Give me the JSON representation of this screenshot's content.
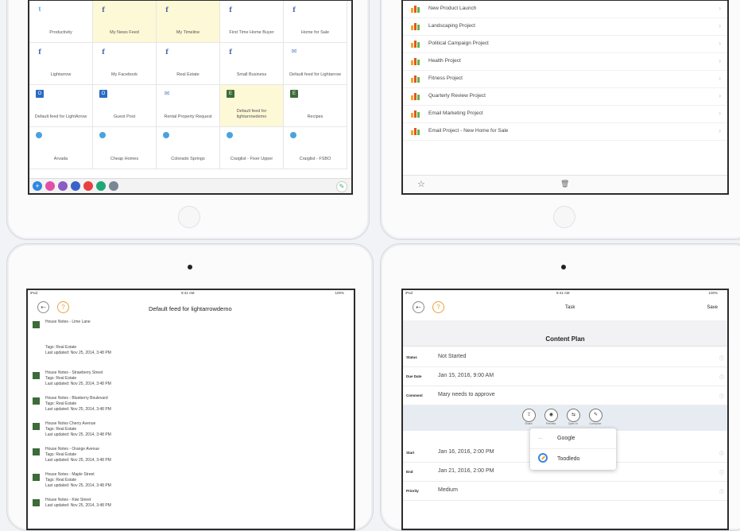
{
  "tl_grid": [
    {
      "icon": "twitter-icon",
      "glyph": "t",
      "cls": "tw",
      "label": "Productivity",
      "hl": false
    },
    {
      "icon": "facebook-icon",
      "glyph": "f",
      "cls": "fb",
      "label": "My News Feed",
      "hl": true
    },
    {
      "icon": "facebook-icon",
      "glyph": "f",
      "cls": "fb",
      "label": "My Timeline",
      "hl": true
    },
    {
      "icon": "facebook-icon",
      "glyph": "f",
      "cls": "fb",
      "label": "First Time Home Buyer",
      "hl": false
    },
    {
      "icon": "facebook-icon",
      "glyph": "f",
      "cls": "fb",
      "label": "Home for Sale",
      "hl": false
    },
    {
      "icon": "facebook-icon",
      "glyph": "f",
      "cls": "fb",
      "label": "Lightarrow",
      "hl": false
    },
    {
      "icon": "facebook-icon",
      "glyph": "f",
      "cls": "fb",
      "label": "My Facebook",
      "hl": false
    },
    {
      "icon": "facebook-icon",
      "glyph": "f",
      "cls": "fb",
      "label": "Real Estate",
      "hl": false
    },
    {
      "icon": "facebook-icon",
      "glyph": "f",
      "cls": "fb",
      "label": "Small Business",
      "hl": false
    },
    {
      "icon": "mail-icon",
      "glyph": "✉",
      "cls": "mail",
      "label": "Default feed for Lightarrow",
      "hl": false
    },
    {
      "icon": "outlook-icon",
      "glyph": "O",
      "cls": "ol",
      "label": "Default feed for LightArrow",
      "hl": false
    },
    {
      "icon": "outlook-icon",
      "glyph": "O",
      "cls": "ol",
      "label": "Guest Post",
      "hl": false
    },
    {
      "icon": "mail-icon",
      "glyph": "✉",
      "cls": "mail",
      "label": "Rental Property Request",
      "hl": false
    },
    {
      "icon": "evernote-icon",
      "glyph": "E",
      "cls": "ev",
      "label": "Default feed for lightarrowdemo",
      "hl": true
    },
    {
      "icon": "evernote-icon",
      "glyph": "E",
      "cls": "ev",
      "label": "Recipes",
      "hl": false
    },
    {
      "icon": "globe-icon",
      "glyph": "",
      "cls": "gl",
      "label": "Arvada",
      "hl": false
    },
    {
      "icon": "globe-icon",
      "glyph": "",
      "cls": "gl",
      "label": "Cheap Homes",
      "hl": false
    },
    {
      "icon": "globe-icon",
      "glyph": "",
      "cls": "gl",
      "label": "Colorado Springs",
      "hl": false
    },
    {
      "icon": "globe-icon",
      "glyph": "",
      "cls": "gl",
      "label": "Craiglist - Fixer Upper",
      "hl": false
    },
    {
      "icon": "globe-icon",
      "glyph": "",
      "cls": "gl",
      "label": "Craiglist - FSBO",
      "hl": false
    }
  ],
  "tl_dock": [
    {
      "name": "dock-add-icon",
      "color": "#2f86e0",
      "glyph": "+"
    },
    {
      "name": "dock-pink-icon",
      "color": "#e24fa8",
      "glyph": ""
    },
    {
      "name": "dock-purple-icon",
      "color": "#8a5cc4",
      "glyph": ""
    },
    {
      "name": "dock-blue-icon",
      "color": "#3a63c9",
      "glyph": ""
    },
    {
      "name": "dock-red-icon",
      "color": "#e84040",
      "glyph": ""
    },
    {
      "name": "dock-green-icon",
      "color": "#21a67a",
      "glyph": ""
    },
    {
      "name": "dock-gray-icon",
      "color": "#7b8594",
      "glyph": ""
    }
  ],
  "tr_projects": [
    "New Product Launch",
    "Landscaping Project",
    "Political Campaign Project",
    "Health Project",
    "Fitness Project",
    "Quarterly Review Project",
    "Email Marketing Project",
    "Email Project - New Home for Sale"
  ],
  "bl": {
    "title": "Default feed for lightarrowdemo",
    "carrier": "iPod",
    "time": "9:41 AM",
    "battery": "100%",
    "items": [
      {
        "title": "House Notes - Lime Lane",
        "tags": "",
        "updated": ""
      },
      {
        "title": "",
        "tags": "Tags: Real Estate",
        "updated": "Last updated: Nov 25, 2014, 3:48 PM"
      },
      {
        "title": "House Notes - Strawberry Street",
        "tags": "Tags: Real Estate",
        "updated": "Last updated: Nov 25, 2014, 3:48 PM"
      },
      {
        "title": "House Notes - Blueberry Boulevard",
        "tags": "Tags: Real Estate",
        "updated": "Last updated: Nov 25, 2014, 3:48 PM"
      },
      {
        "title": "House Notes Cherry Avenue",
        "tags": "Tags: Real Estate",
        "updated": "Last updated: Nov 25, 2014, 3:48 PM"
      },
      {
        "title": "House Notes - Orange Avenue",
        "tags": "Tags: Real Estate",
        "updated": "Last updated: Nov 25, 2014, 3:48 PM"
      },
      {
        "title": "House Notes - Maple Street",
        "tags": "Tags: Real Estate",
        "updated": "Last updated: Nov 25, 2014, 3:48 PM"
      },
      {
        "title": "House Notes - Kiwi Street",
        "tags": "",
        "updated": "Last updated: Nov 25, 2014, 3:48 PM"
      }
    ]
  },
  "br": {
    "carrier": "iPod",
    "time": "9:41 AM",
    "battery": "100%",
    "nav_title": "Task",
    "save_label": "Save",
    "section_label": "Content Plan",
    "rows": [
      {
        "k": "Status",
        "v": "Not Started"
      },
      {
        "k": "Due Date",
        "v": "Jan 15, 2016, 9:00 AM"
      },
      {
        "k": "Comment",
        "v": "Mary needs to approve"
      },
      {
        "k": "Start",
        "v": "Jan 16, 2016, 2:00 PM"
      },
      {
        "k": "End",
        "v": "Jan 21, 2016, 2:00 PM"
      },
      {
        "k": "Priority",
        "v": "Medium"
      }
    ],
    "actions": [
      "Share",
      "Preview",
      "Open In",
      "Compose"
    ],
    "popover": [
      {
        "label": "Google",
        "icon": "google-icon"
      },
      {
        "label": "Toodledo",
        "icon": "toodledo-icon"
      }
    ]
  }
}
